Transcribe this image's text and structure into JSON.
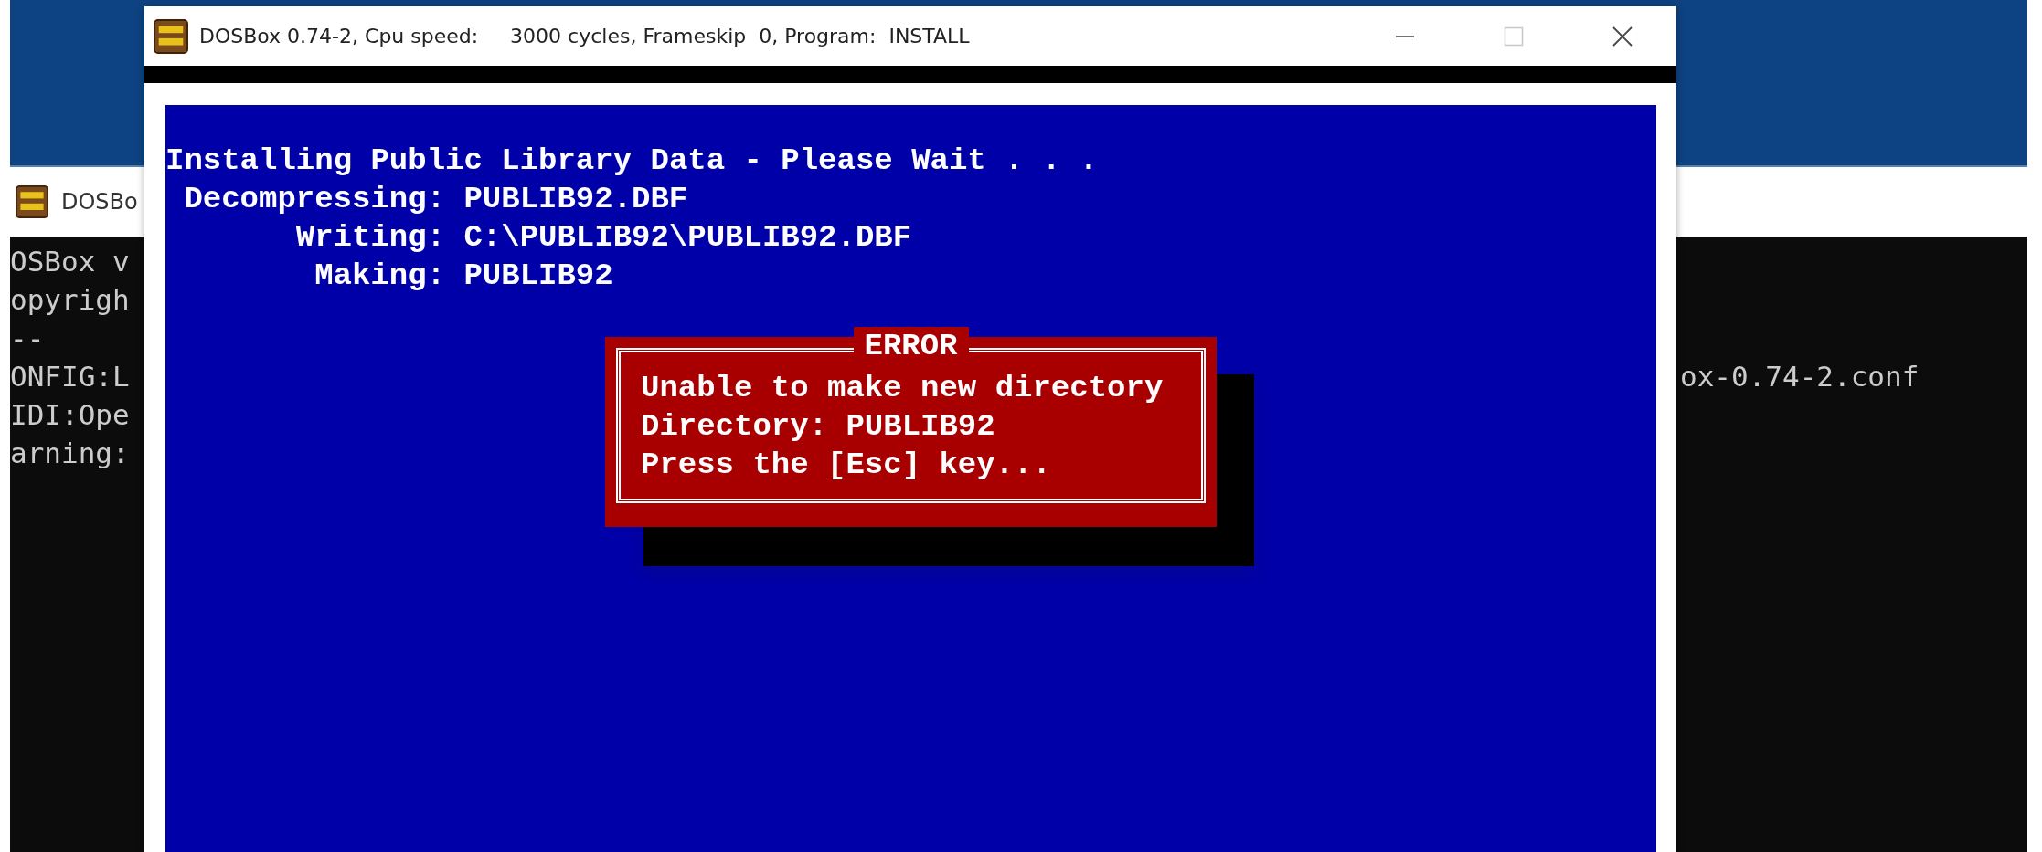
{
  "background_window": {
    "title": "DOSBo",
    "lines": [
      {
        "left": "OSBox v"
      },
      {
        "left": "opyrigh"
      },
      {
        "left": "--"
      },
      {
        "left": "ONFIG:L",
        "right": "ox-0.74-2.conf"
      },
      {
        "left": "IDI:Ope"
      },
      {
        "left": "arning:"
      }
    ]
  },
  "dosbox_window": {
    "title": "DOSBox 0.74-2, Cpu speed:     3000 cycles, Frameskip  0, Program:  INSTALL",
    "controls": [
      {
        "kind": "minimize",
        "disabled": false
      },
      {
        "kind": "maximize",
        "disabled": true
      },
      {
        "kind": "close",
        "disabled": false
      }
    ],
    "screen": {
      "heading": "Installing Public Library Data - Please Wait . . .",
      "status": [
        {
          "label": "Decompressing:",
          "value": "PUBLIB92.DBF"
        },
        {
          "label": "Writing:",
          "value": "C:\\PUBLIB92\\PUBLIB92.DBF"
        },
        {
          "label": "Making:",
          "value": "PUBLIB92"
        }
      ],
      "error_dialog": {
        "title": "ERROR",
        "lines": [
          "Unable to make new directory",
          "Directory: PUBLIB92",
          "Press the [Esc] key..."
        ]
      }
    }
  }
}
